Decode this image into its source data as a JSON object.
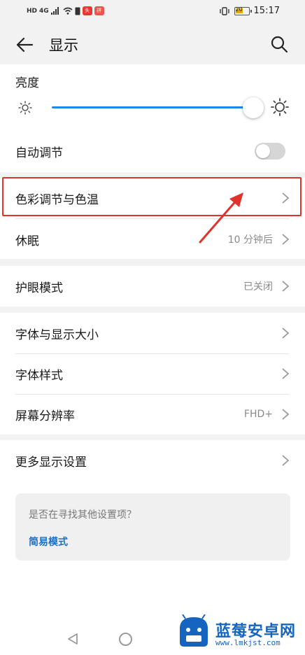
{
  "status_bar": {
    "left_mini": "HD",
    "network": "4G",
    "time": "15:17",
    "battery_level": "20"
  },
  "header": {
    "title": "显示",
    "back_icon": "arrow-left-icon",
    "search_icon": "search-icon"
  },
  "brightness": {
    "label": "亮度",
    "level_percent": 100
  },
  "auto_adjust": {
    "label": "自动调节",
    "enabled": false
  },
  "rows": {
    "color_temp": {
      "label": "色彩调节与色温"
    },
    "sleep": {
      "label": "休眠",
      "value": "10 分钟后"
    },
    "eye_comfort": {
      "label": "护眼模式",
      "value": "已关闭"
    },
    "font_size": {
      "label": "字体与显示大小"
    },
    "font_style": {
      "label": "字体样式"
    },
    "resolution": {
      "label": "屏幕分辨率",
      "value": "FHD+"
    },
    "more": {
      "label": "更多显示设置"
    }
  },
  "help": {
    "question": "是否在寻找其他设置项？",
    "link": "简易模式"
  },
  "watermark": {
    "name": "蓝莓安卓网",
    "url": "www.lmkjst.com"
  },
  "colors": {
    "accent": "#1e88e5",
    "highlight": "#e0332e",
    "link": "#1e6fc9"
  }
}
